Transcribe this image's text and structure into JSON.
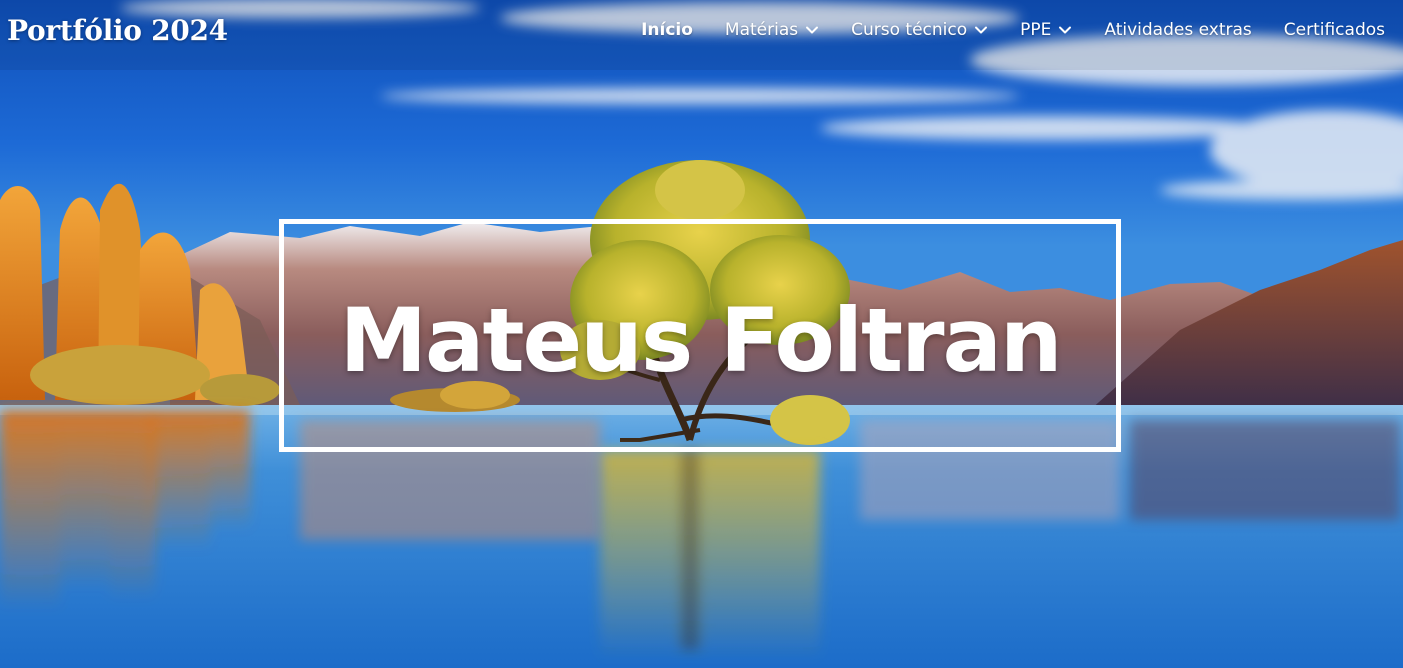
{
  "brand": {
    "title": "Portfólio 2024"
  },
  "nav": {
    "items": [
      {
        "label": "Início",
        "active": true,
        "has_dropdown": false,
        "icon": ""
      },
      {
        "label": "Matérias",
        "active": false,
        "has_dropdown": true,
        "icon": "chevron-down-icon"
      },
      {
        "label": "Curso técnico",
        "active": false,
        "has_dropdown": true,
        "icon": "chevron-down-icon"
      },
      {
        "label": "PPE",
        "active": false,
        "has_dropdown": true,
        "icon": "chevron-down-icon"
      },
      {
        "label": "Atividades extras",
        "active": false,
        "has_dropdown": false,
        "icon": ""
      },
      {
        "label": "Certificados",
        "active": false,
        "has_dropdown": false,
        "icon": ""
      }
    ]
  },
  "hero": {
    "name": "Mateus Foltran",
    "background_description_colors": {
      "sky": "#1a63c9",
      "lake": "#2d7fd4",
      "autumn_trees": "#e58a1a",
      "tree_foliage": "#c9c02c",
      "mountains": "#7a6a86"
    }
  }
}
